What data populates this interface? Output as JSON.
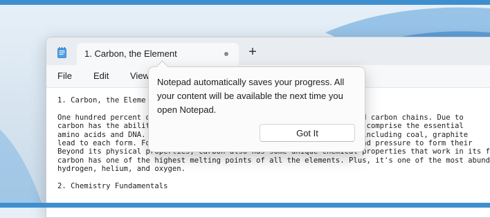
{
  "tab": {
    "title": "1. Carbon, the Element",
    "new_tab_label": "+"
  },
  "menu": {
    "file": "File",
    "edit": "Edit",
    "view": "View"
  },
  "editor": {
    "lines": [
      "1. Carbon, the Eleme",
      "",
      "One hundred percent o                                           varied carbon chains. Due to",
      "carbon has the abilit                                           hains comprise the essential",
      "amino acids and DNA.                                            rms, including coal, graphite",
      "lead to each form. Fo                                           eat and pressure to form their",
      "Beyond its physical properties, carbon also has some unique chemical properties that work in its f",
      "carbon has one of the highest melting points of all the elements. Plus, it's one of the most abund",
      "hydrogen, helium, and oxygen.",
      "",
      "2. Chemistry Fundamentals"
    ]
  },
  "teaching_tip": {
    "message": "Notepad automatically saves your progress. All your content will be available the next time you open Notepad.",
    "button_label": "Got It"
  },
  "colors": {
    "taskbar_accent": "#3f8fcf",
    "window_bg": "#ffffff",
    "tabstrip_bg": "#e9edf1"
  },
  "icons": {
    "app": "notepad-icon",
    "unsaved": "unsaved-dot-icon",
    "new_tab": "plus-icon"
  }
}
